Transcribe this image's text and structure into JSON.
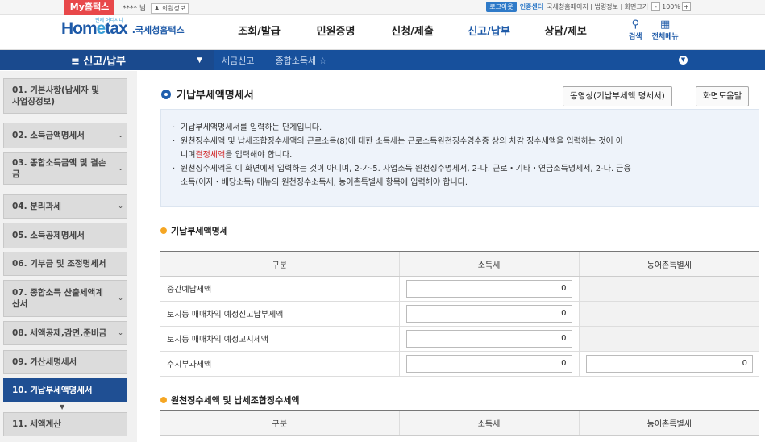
{
  "topbar": {
    "my_tab": "My홈택스",
    "user_name": "**** 님",
    "member_info": "회원정보",
    "logout": "로그아웃",
    "cert_center": "인증센터",
    "links": "국세청홈페이지 | 법령정보 | 화면크기",
    "zoom_minus": "-",
    "zoom_value": "100%",
    "zoom_plus": "+"
  },
  "header": {
    "logo_tagline": "언제 어디서나",
    "logo_home": "Hom",
    "logo_e": "e",
    "logo_tax": "tax",
    "logo_org": ".국세청홈택스",
    "nav": [
      "조회/발급",
      "민원증명",
      "신청/제출",
      "신고/납부",
      "상담/제보"
    ],
    "active_nav": "신고/납부",
    "search_label": "검색",
    "all_menu_label": "전체메뉴"
  },
  "subbar": {
    "menu_label": "≡  신고/납부",
    "crumbs": [
      "세금신고",
      "종합소득세"
    ]
  },
  "sidebar": {
    "items": [
      {
        "label": "01. 기본사항(납세자 및 사업장정보)",
        "dropdown": false
      },
      {
        "label": "02. 소득금액명세서",
        "dropdown": true
      },
      {
        "label": "03. 종합소득금액 및 결손금",
        "dropdown": true
      },
      {
        "label": "04. 분리과세",
        "dropdown": true
      },
      {
        "label": "05. 소득공제명세서",
        "dropdown": false
      },
      {
        "label": "06. 기부금 및 조정명세서",
        "dropdown": false
      },
      {
        "label": "07. 종합소득 산출세액계산서",
        "dropdown": true
      },
      {
        "label": "08. 세액공제,감면,준비금",
        "dropdown": true
      },
      {
        "label": "09. 가산세명세서",
        "dropdown": false
      },
      {
        "label": "10. 기납부세액명세서",
        "dropdown": false
      },
      {
        "label": "11. 세액계산",
        "dropdown": false
      }
    ],
    "active_index": 9
  },
  "page": {
    "title": "기납부세액명세서",
    "video_button": "동영상(기납부세액 명세서)",
    "help_button": "화면도움말",
    "notice": {
      "line1": "기납부세액명세서를 입력하는 단계입니다.",
      "line2": "원천징수세액 및 납세조합징수세액의 근로소득(8)에 대한 소득세는 근로소득원천징수영수증 상의 차감 징수세액을 입력하는 것이 아",
      "line2b_pre": "니며",
      "line2b_red": "결정세액",
      "line2b_post": "을 입력해야 합니다.",
      "line3": "원천징수세액은 이 화면에서 입력하는 것이 아니며, 2-가-5. 사업소득 원천징수명세서, 2-나. 근로・기타・연금소득명세서, 2-다. 금융",
      "line3b": "소득(이자・배당소득) 메뉴의 원천징수소득세, 농어촌특별세 항목에 입력해야 합니다."
    }
  },
  "section1": {
    "title": "기납부세액명세",
    "headers": [
      "구분",
      "소득세",
      "농어촌특별세"
    ],
    "rows": [
      {
        "label": "중간예납세액",
        "income_tax": "0",
        "rural_tax": null
      },
      {
        "label": "토지등 매매차익 예정신고납부세액",
        "income_tax": "0",
        "rural_tax": null
      },
      {
        "label": "토지등 매매차익 예정고지세액",
        "income_tax": "0",
        "rural_tax": null
      },
      {
        "label": "수시부과세액",
        "income_tax": "0",
        "rural_tax": "0"
      }
    ]
  },
  "section2": {
    "title": "원천징수세액 및 납세조합징수세액",
    "headers": [
      "구분",
      "소득세",
      "농어촌특별세"
    ]
  },
  "colors": {
    "brand_blue": "#1e5aa8",
    "subbar_blue": "#17509c",
    "active_side": "#1f4f93",
    "my_tab_red": "#e8484a",
    "section_dot": "#f5a623"
  }
}
